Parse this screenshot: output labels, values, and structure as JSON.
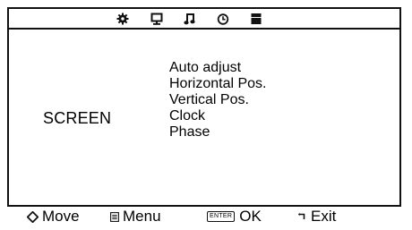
{
  "tabs": [
    {
      "icon": "gear-icon"
    },
    {
      "icon": "monitor-icon"
    },
    {
      "icon": "music-note-icon"
    },
    {
      "icon": "clock-icon"
    },
    {
      "icon": "block-icon"
    }
  ],
  "section_title": "SCREEN",
  "menu_items": [
    "Auto adjust",
    "Horizontal Pos.",
    "Vertical Pos.",
    "Clock",
    "Phase"
  ],
  "footer": {
    "move_label": "Move",
    "menu_label": "Menu",
    "enter_key_label": "ENTER",
    "ok_label": "OK",
    "exit_label": "Exit"
  }
}
